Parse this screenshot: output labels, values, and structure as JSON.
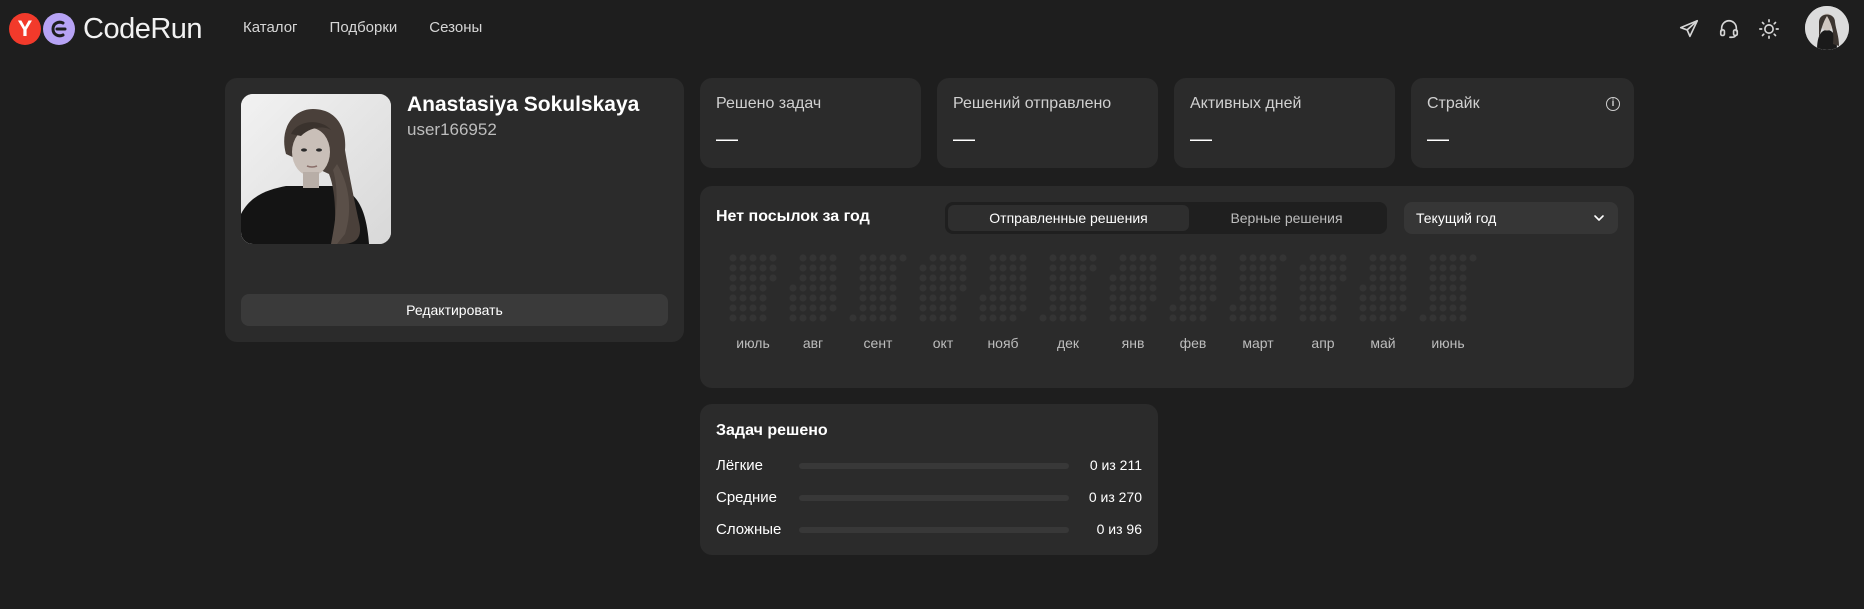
{
  "header": {
    "logo_letter": "Y",
    "logo_text": "CodeRun",
    "nav": [
      "Каталог",
      "Подборки",
      "Сезоны"
    ],
    "icons": [
      "telegram-icon",
      "support-headset-icon",
      "theme-sun-icon"
    ]
  },
  "profile": {
    "name": "Anastasiya Sokulskaya",
    "username": "user166952",
    "edit_label": "Редактировать"
  },
  "stats": [
    {
      "label": "Решено задач",
      "value": "—"
    },
    {
      "label": "Решений отправлено",
      "value": "—"
    },
    {
      "label": "Активных дней",
      "value": "—"
    },
    {
      "label": "Страйк",
      "value": "—"
    }
  ],
  "activity": {
    "title": "Нет посылок за год",
    "tabs": [
      "Отправленные решения",
      "Верные решения"
    ],
    "active_tab": 0,
    "period_select": "Текущий год",
    "months": [
      "июль",
      "авг",
      "сент",
      "окт",
      "нояб",
      "дек",
      "янв",
      "фев",
      "март",
      "апр",
      "май",
      "июнь"
    ]
  },
  "tasks": {
    "title": "Задач решено",
    "rows": [
      {
        "label": "Лёгкие",
        "value": "0 из 211",
        "fraction": 0
      },
      {
        "label": "Средние",
        "value": "0 из 270",
        "fraction": 0
      },
      {
        "label": "Сложные",
        "value": "0 из 96",
        "fraction": 0
      }
    ]
  },
  "colors": {
    "background": "#1e1e1e",
    "card": "#2b2b2b",
    "logo_red": "#f23a2b",
    "logo_purple": "#b7a3f5",
    "empty_day": "#343434"
  }
}
